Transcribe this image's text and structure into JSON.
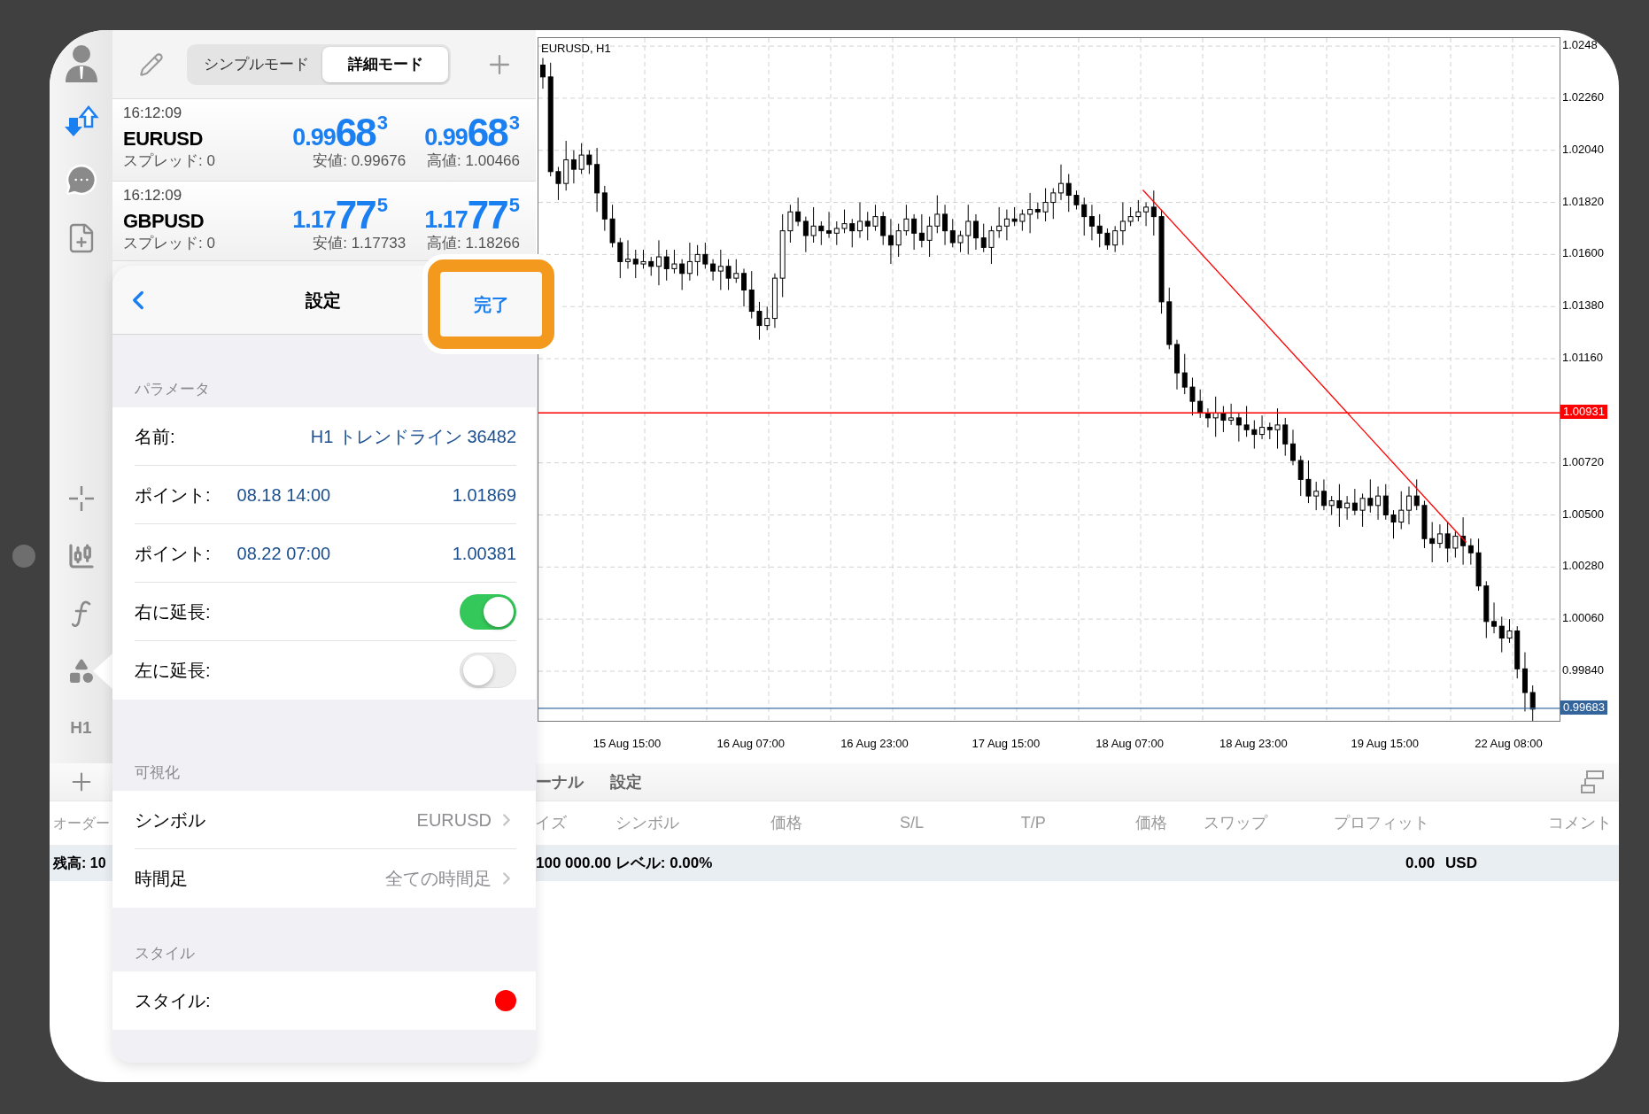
{
  "rail": {
    "top_items": [
      {
        "kind": "account"
      },
      {
        "kind": "trade"
      },
      {
        "kind": "chat"
      },
      {
        "kind": "newdoc"
      }
    ],
    "tools": [
      {
        "kind": "crosshair",
        "selected": false
      },
      {
        "kind": "candles",
        "selected": false
      },
      {
        "kind": "function",
        "selected": false
      },
      {
        "kind": "objects",
        "selected": true
      },
      {
        "kind": "timeframe",
        "label": "H1",
        "selected": false
      }
    ]
  },
  "toolbar": {
    "modes": [
      {
        "label": "シンプルモード",
        "selected": false
      },
      {
        "label": "詳細モード",
        "selected": true
      }
    ]
  },
  "quotes": [
    {
      "time": "16:12:09",
      "symbol": "EURUSD",
      "spread": "スプレッド: 0",
      "bid": {
        "lead": "0.99",
        "big": "68",
        "tail": "3"
      },
      "ask": {
        "lead": "0.99",
        "big": "68",
        "tail": "3"
      },
      "low": "安値: 0.99676",
      "high": "高値: 1.00466"
    },
    {
      "time": "16:12:09",
      "symbol": "GBPUSD",
      "spread": "スプレッド: 0",
      "bid": {
        "lead": "1.17",
        "big": "77",
        "tail": "5"
      },
      "ask": {
        "lead": "1.17",
        "big": "77",
        "tail": "5"
      },
      "low": "安値: 1.17733",
      "high": "高値: 1.18266"
    }
  ],
  "settings": {
    "title": "設定",
    "done": "完了",
    "done_highlighted": true,
    "sections": [
      {
        "header": "パラメータ",
        "rows": [
          {
            "kind": "text",
            "label": "名前:",
            "value": "H1 トレンドライン 36482"
          },
          {
            "kind": "point",
            "label": "ポイント:",
            "time": "08.18 14:00",
            "price": "1.01869"
          },
          {
            "kind": "point",
            "label": "ポイント:",
            "time": "08.22 07:00",
            "price": "1.00381"
          },
          {
            "kind": "toggle",
            "label": "右に延長:",
            "on": true
          },
          {
            "kind": "toggle",
            "label": "左に延長:",
            "on": false
          }
        ]
      },
      {
        "header": "可視化",
        "rows": [
          {
            "kind": "link",
            "label": "シンボル",
            "value": "EURUSD"
          },
          {
            "kind": "link",
            "label": "時間足",
            "value": "全ての時間足"
          }
        ]
      },
      {
        "header": "スタイル",
        "rows": [
          {
            "kind": "color",
            "label": "スタイル:",
            "color": "#ff0000"
          }
        ]
      }
    ]
  },
  "chart": {
    "line_price": "1.00931",
    "bid_price": "0.99683",
    "chart_data": {
      "type": "candlestick",
      "title": "EURUSD, H1",
      "ylim": [
        0.99623,
        1.02514
      ],
      "grid": true,
      "ref_lines": [
        {
          "axis": "y",
          "value": 1.00931,
          "color": "#ff0000"
        },
        {
          "axis": "y",
          "value": 0.99683,
          "color": "#3a6ea5"
        }
      ],
      "yticks": [
        {
          "value": 1.0248,
          "label": "1.0248"
        },
        {
          "value": 1.0226,
          "label": "1.02260"
        },
        {
          "value": 1.0204,
          "label": "1.02040"
        },
        {
          "value": 1.0182,
          "label": "1.01820"
        },
        {
          "value": 1.016,
          "label": "1.01600"
        },
        {
          "value": 1.0138,
          "label": "1.01380"
        },
        {
          "value": 1.0116,
          "label": "1.01160"
        },
        {
          "value": 1.0072,
          "label": "1.00720"
        },
        {
          "value": 1.005,
          "label": "1.00500"
        },
        {
          "value": 1.0028,
          "label": "1.00280"
        },
        {
          "value": 1.0006,
          "label": "1.00060"
        },
        {
          "value": 0.9984,
          "label": "0.99840"
        }
      ],
      "categories": [
        null,
        null,
        null,
        null,
        null,
        null,
        null,
        null,
        null,
        null,
        null,
        "15 Aug 15:00",
        null,
        null,
        null,
        null,
        null,
        null,
        null,
        null,
        null,
        null,
        null,
        null,
        null,
        null,
        null,
        "16 Aug 07:00",
        null,
        null,
        null,
        null,
        null,
        null,
        null,
        null,
        null,
        null,
        null,
        null,
        null,
        null,
        null,
        "16 Aug 23:00",
        null,
        null,
        null,
        null,
        null,
        null,
        null,
        null,
        null,
        null,
        null,
        null,
        null,
        null,
        null,
        null,
        "17 Aug 15:00",
        null,
        null,
        null,
        null,
        null,
        null,
        null,
        null,
        null,
        null,
        null,
        null,
        null,
        null,
        null,
        "18 Aug 07:00",
        null,
        null,
        null,
        null,
        null,
        null,
        null,
        null,
        null,
        null,
        null,
        null,
        null,
        null,
        null,
        "18 Aug 23:00",
        null,
        null,
        null,
        null,
        null,
        null,
        null,
        null,
        null,
        null,
        null,
        null,
        null,
        null,
        null,
        null,
        "19 Aug 15:00",
        null,
        null,
        null,
        null,
        null,
        null,
        null,
        null,
        null,
        null,
        null,
        null,
        null,
        null,
        null,
        "22 Aug 08:00",
        null,
        null,
        null
      ],
      "ohlc": [
        [
          1.024,
          1.0243,
          1.023,
          1.0235
        ],
        [
          1.0235,
          1.0241,
          1.0193,
          1.0195
        ],
        [
          1.0195,
          1.0197,
          1.0183,
          1.019
        ],
        [
          1.019,
          1.0208,
          1.0187,
          1.02
        ],
        [
          1.02,
          1.0204,
          1.019,
          1.0196
        ],
        [
          1.0196,
          1.0207,
          1.0194,
          1.0202
        ],
        [
          1.0202,
          1.0204,
          1.0194,
          1.0198
        ],
        [
          1.0198,
          1.0205,
          1.0178,
          1.0186
        ],
        [
          1.0186,
          1.0189,
          1.017,
          1.0175
        ],
        [
          1.0175,
          1.0181,
          1.0163,
          1.0165
        ],
        [
          1.0165,
          1.0167,
          1.015,
          1.0157
        ],
        [
          1.0157,
          1.0166,
          1.0154,
          1.0158
        ],
        [
          1.0158,
          1.0162,
          1.015,
          1.0156
        ],
        [
          1.0156,
          1.0162,
          1.0154,
          1.0157
        ],
        [
          1.0157,
          1.0159,
          1.0151,
          1.0155
        ],
        [
          1.0155,
          1.0166,
          1.0147,
          1.0159
        ],
        [
          1.0159,
          1.0162,
          1.0149,
          1.0154
        ],
        [
          1.0154,
          1.0162,
          1.0152,
          1.0156
        ],
        [
          1.0156,
          1.0158,
          1.0145,
          1.0152
        ],
        [
          1.0152,
          1.0165,
          1.0149,
          1.0157
        ],
        [
          1.0157,
          1.0164,
          1.0151,
          1.016
        ],
        [
          1.016,
          1.0165,
          1.0154,
          1.0156
        ],
        [
          1.0156,
          1.0158,
          1.0149,
          1.0153
        ],
        [
          1.0153,
          1.0162,
          1.0145,
          1.0155
        ],
        [
          1.0155,
          1.0158,
          1.0145,
          1.015
        ],
        [
          1.015,
          1.0158,
          1.0148,
          1.0152
        ],
        [
          1.0152,
          1.0154,
          1.0138,
          1.0145
        ],
        [
          1.0145,
          1.0153,
          1.0133,
          1.0136
        ],
        [
          1.0136,
          1.014,
          1.0124,
          1.013
        ],
        [
          1.013,
          1.0138,
          1.0128,
          1.0133
        ],
        [
          1.0133,
          1.0152,
          1.0129,
          1.015
        ],
        [
          1.015,
          1.0177,
          1.0142,
          1.017
        ],
        [
          1.017,
          1.0181,
          1.0165,
          1.0178
        ],
        [
          1.0178,
          1.0184,
          1.0172,
          1.0174
        ],
        [
          1.0174,
          1.0176,
          1.0161,
          1.0168
        ],
        [
          1.0168,
          1.018,
          1.0165,
          1.0172
        ],
        [
          1.0172,
          1.0174,
          1.0164,
          1.017
        ],
        [
          1.017,
          1.0178,
          1.0167,
          1.0169
        ],
        [
          1.0169,
          1.0174,
          1.0164,
          1.0171
        ],
        [
          1.0171,
          1.0179,
          1.0169,
          1.0173
        ],
        [
          1.0173,
          1.0175,
          1.0163,
          1.017
        ],
        [
          1.017,
          1.0182,
          1.0167,
          1.0174
        ],
        [
          1.0174,
          1.0178,
          1.0166,
          1.0172
        ],
        [
          1.0172,
          1.0181,
          1.017,
          1.0176
        ],
        [
          1.0176,
          1.0178,
          1.0164,
          1.0168
        ],
        [
          1.0168,
          1.0175,
          1.0156,
          1.0164
        ],
        [
          1.0164,
          1.0173,
          1.0159,
          1.017
        ],
        [
          1.017,
          1.0181,
          1.0168,
          1.0175
        ],
        [
          1.0175,
          1.0177,
          1.0162,
          1.0169
        ],
        [
          1.0169,
          1.0177,
          1.0163,
          1.0166
        ],
        [
          1.0166,
          1.0176,
          1.0159,
          1.0172
        ],
        [
          1.0172,
          1.0185,
          1.0169,
          1.0177
        ],
        [
          1.0177,
          1.0181,
          1.0164,
          1.017
        ],
        [
          1.017,
          1.0175,
          1.0163,
          1.0165
        ],
        [
          1.0165,
          1.017,
          1.0161,
          1.0168
        ],
        [
          1.0168,
          1.0181,
          1.016,
          1.0174
        ],
        [
          1.0174,
          1.0177,
          1.0162,
          1.0167
        ],
        [
          1.0167,
          1.0173,
          1.0161,
          1.0163
        ],
        [
          1.0163,
          1.0172,
          1.0156,
          1.017
        ],
        [
          1.017,
          1.018,
          1.0167,
          1.0172
        ],
        [
          1.0172,
          1.0179,
          1.0166,
          1.0175
        ],
        [
          1.0175,
          1.018,
          1.0172,
          1.0174
        ],
        [
          1.0174,
          1.0179,
          1.017,
          1.0177
        ],
        [
          1.0177,
          1.0186,
          1.0169,
          1.0179
        ],
        [
          1.0179,
          1.0182,
          1.0175,
          1.0178
        ],
        [
          1.0178,
          1.0188,
          1.0174,
          1.0182
        ],
        [
          1.0182,
          1.0188,
          1.0175,
          1.0186
        ],
        [
          1.0186,
          1.0198,
          1.0183,
          1.019
        ],
        [
          1.019,
          1.0194,
          1.0178,
          1.0185
        ],
        [
          1.0185,
          1.0187,
          1.0179,
          1.0181
        ],
        [
          1.0181,
          1.0184,
          1.0168,
          1.0176
        ],
        [
          1.0176,
          1.0181,
          1.0166,
          1.0172
        ],
        [
          1.0172,
          1.0177,
          1.0163,
          1.0169
        ],
        [
          1.0169,
          1.0171,
          1.0162,
          1.0164
        ],
        [
          1.0164,
          1.0172,
          1.0161,
          1.017
        ],
        [
          1.017,
          1.0182,
          1.0164,
          1.0174
        ],
        [
          1.0174,
          1.018,
          1.0172,
          1.0176
        ],
        [
          1.0176,
          1.0183,
          1.0174,
          1.0178
        ],
        [
          1.0178,
          1.0182,
          1.0172,
          1.018
        ],
        [
          1.018,
          1.0187,
          1.0168,
          1.0176
        ],
        [
          1.0176,
          1.0179,
          1.0135,
          1.014
        ],
        [
          1.014,
          1.0146,
          1.012,
          1.0122
        ],
        [
          1.0122,
          1.0124,
          1.0103,
          1.011
        ],
        [
          1.011,
          1.0118,
          1.0101,
          1.0104
        ],
        [
          1.0104,
          1.0108,
          1.0092,
          1.0098
        ],
        [
          1.0098,
          1.0103,
          1.0091,
          1.0093
        ],
        [
          1.0093,
          1.0095,
          1.0087,
          1.0091
        ],
        [
          1.0091,
          1.01,
          1.0083,
          1.0093
        ],
        [
          1.0093,
          1.0096,
          1.0085,
          1.009
        ],
        [
          1.009,
          1.0097,
          1.0088,
          1.0091
        ],
        [
          1.0091,
          1.0093,
          1.0081,
          1.0088
        ],
        [
          1.0088,
          1.0096,
          1.0083,
          1.0086
        ],
        [
          1.0086,
          1.009,
          1.0078,
          1.0084
        ],
        [
          1.0084,
          1.0092,
          1.0082,
          1.0087
        ],
        [
          1.0087,
          1.0089,
          1.0082,
          1.0086
        ],
        [
          1.0086,
          1.0095,
          1.0078,
          1.0088
        ],
        [
          1.0088,
          1.0091,
          1.0075,
          1.008
        ],
        [
          1.008,
          1.0086,
          1.0071,
          1.0073
        ],
        [
          1.0073,
          1.0075,
          1.0058,
          1.0065
        ],
        [
          1.0065,
          1.0073,
          1.0055,
          1.0058
        ],
        [
          1.0058,
          1.0064,
          1.0052,
          1.006
        ],
        [
          1.006,
          1.0065,
          1.0052,
          1.0054
        ],
        [
          1.0054,
          1.0058,
          1.005,
          1.0056
        ],
        [
          1.0056,
          1.0063,
          1.0045,
          1.0053
        ],
        [
          1.0053,
          1.0058,
          1.0048,
          1.0055
        ],
        [
          1.0055,
          1.0061,
          1.005,
          1.0052
        ],
        [
          1.0052,
          1.0059,
          1.0045,
          1.0057
        ],
        [
          1.0057,
          1.0065,
          1.0051,
          1.0054
        ],
        [
          1.0054,
          1.0062,
          1.0048,
          1.0058
        ],
        [
          1.0058,
          1.0063,
          1.0048,
          1.005
        ],
        [
          1.005,
          1.0052,
          1.004,
          1.0047
        ],
        [
          1.0047,
          1.006,
          1.0044,
          1.0052
        ],
        [
          1.0052,
          1.0062,
          1.0046,
          1.0058
        ],
        [
          1.0058,
          1.0065,
          1.0052,
          1.0054
        ],
        [
          1.0054,
          1.0056,
          1.0036,
          1.004
        ],
        [
          1.004,
          1.0047,
          1.003,
          1.0038
        ],
        [
          1.0038,
          1.0046,
          1.0036,
          1.0042
        ],
        [
          1.0042,
          1.0047,
          1.003,
          1.0036
        ],
        [
          1.0036,
          1.0043,
          1.0032,
          1.0041
        ],
        [
          1.0041,
          1.0049,
          1.0029,
          1.0037
        ],
        [
          1.0037,
          1.004,
          1.0029,
          1.0034
        ],
        [
          1.0034,
          1.004,
          1.0018,
          1.002
        ],
        [
          1.002,
          1.0022,
          0.9998,
          1.0005
        ],
        [
          1.0005,
          1.0013,
          1.0,
          1.0003
        ],
        [
          1.0003,
          1.0007,
          0.9992,
          0.9998
        ],
        [
          0.9998,
          1.0006,
          0.9996,
          1.0001
        ],
        [
          1.0001,
          1.0003,
          0.9981,
          0.9985
        ],
        [
          0.9985,
          0.9992,
          0.9967,
          0.9975
        ],
        [
          0.9975,
          0.9978,
          0.9963,
          0.9968
        ]
      ]
    }
  },
  "terminal": {
    "left_tab": "オーダー",
    "left_balance": "残高: 10",
    "tabs": [
      "ーナル",
      "設定"
    ],
    "columns": [
      "イズ",
      "シンボル",
      "価格",
      "S/L",
      "T/P",
      "価格",
      "スワップ",
      "プロフィット",
      "コメント"
    ],
    "balance": "100 000.00 レベル: 0.00%",
    "profit": "0.00",
    "currency": "USD"
  }
}
